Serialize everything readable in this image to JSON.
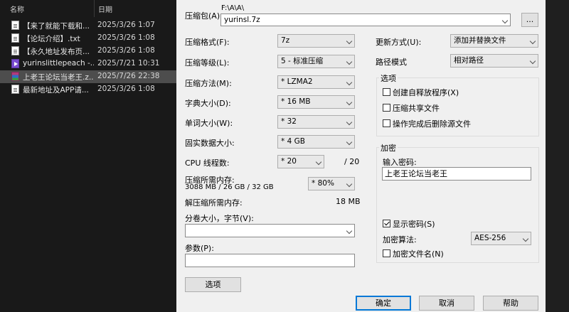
{
  "explorer": {
    "col_name": "名称",
    "col_date": "日期",
    "files": [
      {
        "name": "【来了就能下载和...",
        "date": "2025/3/26 1:07",
        "icon": "text-file-icon"
      },
      {
        "name": "【论坛介绍】.txt",
        "date": "2025/3/26 1:08",
        "icon": "text-file-icon"
      },
      {
        "name": "【永久地址发布页...",
        "date": "2025/3/26 1:08",
        "icon": "text-file-icon"
      },
      {
        "name": "yurinslittlepeach -...",
        "date": "2025/7/21 10:31",
        "icon": "video-file-icon"
      },
      {
        "name": "上老王论坛当老王.z...",
        "date": "2025/7/26 22:38",
        "icon": "archive-file-icon"
      },
      {
        "name": "最新地址及APP请...",
        "date": "2025/3/26 1:08",
        "icon": "text-file-icon"
      }
    ]
  },
  "dialog": {
    "archive_label": "压缩包(A):",
    "archive_path": "F:\\A\\A\\",
    "archive_name": "yurinsl.7z",
    "browse_label": "...",
    "format_label": "压缩格式(F):",
    "format_value": "7z",
    "level_label": "压缩等级(L):",
    "level_value": "5 - 标准压缩",
    "method_label": "压缩方法(M):",
    "method_value": "* LZMA2",
    "dict_label": "字典大小(D):",
    "dict_value": "* 16 MB",
    "word_label": "单词大小(W):",
    "word_value": "* 32",
    "solid_label": "固实数据大小:",
    "solid_value": "* 4 GB",
    "cpu_label": "CPU 线程数:",
    "cpu_value": "* 20",
    "cpu_total": "/ 20",
    "mem_label": "压缩所需内存:",
    "mem_detail": "3088 MB / 26 GB / 32 GB",
    "mem_value": "* 80%",
    "decomp_label": "解压缩所需内存:",
    "decomp_value": "18 MB",
    "volume_label": "分卷大小，字节(V):",
    "volume_value": "",
    "params_label": "参数(P):",
    "params_value": "",
    "options_button": "选项",
    "update_label": "更新方式(U):",
    "update_value": "添加并替换文件",
    "path_label": "路径模式",
    "path_value": "相对路径",
    "options_group": "选项",
    "opt_sfx": "创建自释放程序(X)",
    "opt_shared": "压缩共享文件",
    "opt_delete": "操作完成后删除源文件",
    "encrypt_group": "加密",
    "password_label": "输入密码:",
    "password_value": "上老王论坛当老王",
    "show_password": "显示密码(S)",
    "algo_label": "加密算法:",
    "algo_value": "AES-256",
    "encrypt_names": "加密文件名(N)",
    "ok_button": "确定",
    "cancel_button": "取消",
    "help_button": "帮助"
  }
}
